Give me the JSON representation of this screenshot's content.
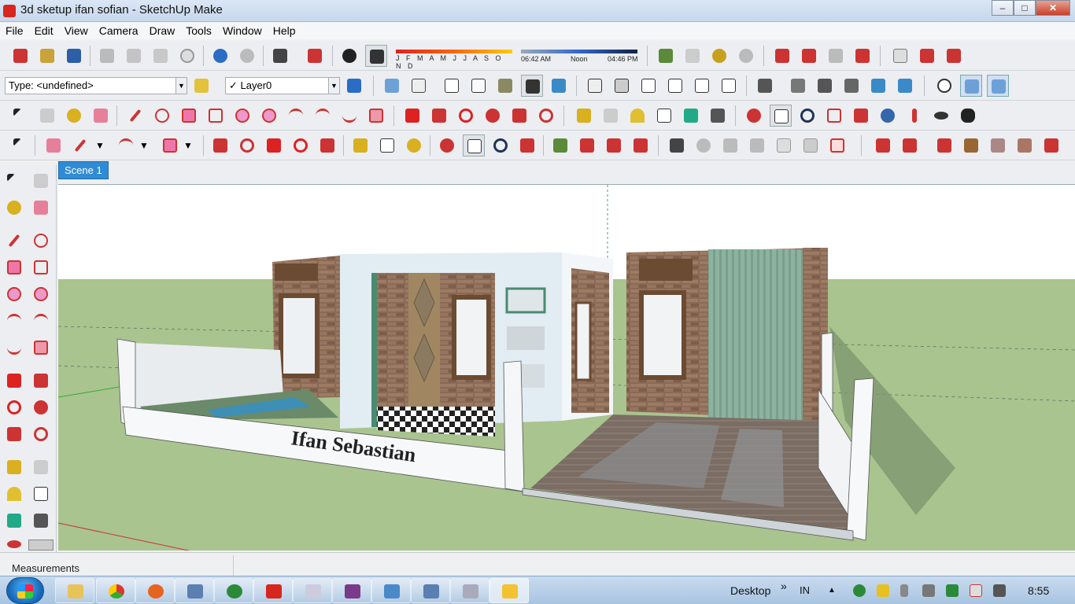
{
  "window": {
    "title": "3d sketup ifan sofian - SketchUp Make",
    "minimize": "–",
    "maximize": "□",
    "close": "✕"
  },
  "menu": [
    "File",
    "Edit",
    "View",
    "Camera",
    "Draw",
    "Tools",
    "Window",
    "Help"
  ],
  "type_combo": {
    "value": "Type: <undefined>"
  },
  "layer_combo": {
    "check": "✓",
    "value": "Layer0"
  },
  "shadow": {
    "months": "J F M A M J J A S O N D",
    "sunrise": "06:42 AM",
    "noon": "Noon",
    "sunset": "04:46 PM"
  },
  "scene_tab": "Scene 1",
  "model_text": "Ifan Sebastian",
  "status": {
    "measurements_label": "Measurements"
  },
  "taskbar": {
    "desktop_label": "Desktop",
    "chevron": "»",
    "lang": "IN",
    "up_arrow": "▲",
    "clock": "8:55"
  },
  "colors": {
    "accent": "#2f8bd6",
    "sky": "#ffffff",
    "ground": "#a9c48f",
    "brick": "#8a6a55",
    "wall": "#e9ecef"
  }
}
